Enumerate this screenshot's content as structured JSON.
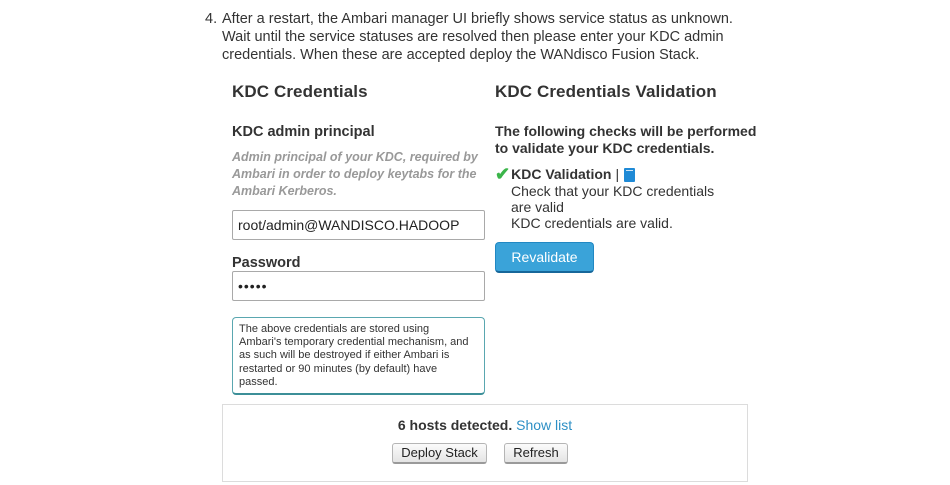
{
  "step": {
    "number": "4.",
    "line1": "After a restart, the Ambari manager UI briefly shows service status as unknown.",
    "line2": "Wait until the service statuses are resolved then please enter your KDC admin",
    "line3": "credentials. When these are accepted deploy the WANdisco Fusion Stack."
  },
  "credentials": {
    "title": "KDC Credentials",
    "principal_label": "KDC admin principal",
    "principal_hint_1": "Admin principal of your KDC, required by",
    "principal_hint_2": "Ambari in order to deploy keytabs for the",
    "principal_hint_3": "Ambari Kerberos.",
    "principal_value": "root/admin@WANDISCO.HADOOP",
    "password_label": "Password",
    "password_value": "•••••",
    "notice_1": "The above credentials are stored using",
    "notice_2": "Ambari's temporary credential mechanism, and",
    "notice_3": "as such will be destroyed if either Ambari is",
    "notice_4": "restarted or 90 minutes (by default) have",
    "notice_5": "passed."
  },
  "validation": {
    "title": "KDC Credentials Validation",
    "desc_1": "The following checks will be performed",
    "desc_2": "to validate your KDC credentials.",
    "check_icon": "checkmark-icon",
    "check_title": "KDC Validation",
    "separator": "|",
    "doc_icon": "book-icon",
    "check_desc_1": "Check that your KDC credentials",
    "check_desc_2": "are valid",
    "result": "KDC credentials are valid.",
    "revalidate_label": "Revalidate",
    "accent_color": "#3aa3d9",
    "success_color": "#3bb54a"
  },
  "footer": {
    "hosts_text": "6 hosts detected.",
    "show_list_label": "Show list",
    "deploy_label": "Deploy Stack",
    "refresh_label": "Refresh"
  }
}
